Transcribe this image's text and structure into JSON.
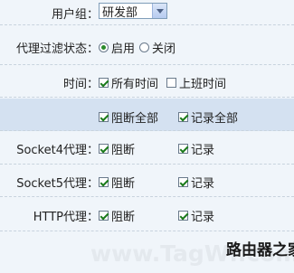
{
  "group": {
    "label": "用户组：",
    "selected": "研发部"
  },
  "proxy_filter": {
    "label": "代理过滤状态：",
    "options": [
      {
        "label": "启用",
        "checked": true
      },
      {
        "label": "关闭",
        "checked": false
      }
    ]
  },
  "time": {
    "label": "时间：",
    "options": [
      {
        "label": "所有时间",
        "checked": true
      },
      {
        "label": "上班时间",
        "checked": false
      }
    ]
  },
  "all_row": {
    "block_all": {
      "label": "阻断全部",
      "checked": true
    },
    "log_all": {
      "label": "记录全部",
      "checked": true
    }
  },
  "proxies": [
    {
      "label": "Socket4代理：",
      "block": "阻断",
      "log": "记录"
    },
    {
      "label": "Socket5代理：",
      "block": "阻断",
      "log": "记录"
    },
    {
      "label": "HTTP代理：",
      "block": "阻断",
      "log": "记录"
    }
  ],
  "watermark": {
    "text": "www.TagWf.com",
    "logo": "路由器之家"
  },
  "colors": {
    "background": "#f0f5fa",
    "highlight_row": "#d4e1f1",
    "check": "#1a7a1a"
  }
}
